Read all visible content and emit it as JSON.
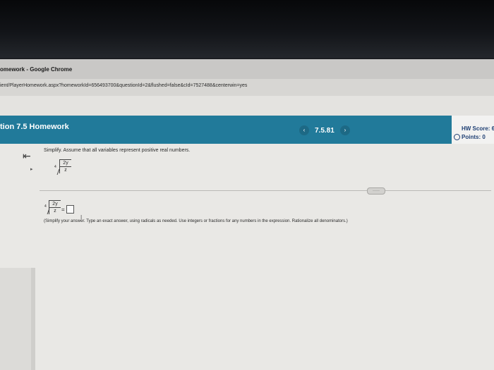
{
  "window": {
    "title": "omework - Google Chrome",
    "url": "ient/PlayerHomework.aspx?homeworkId=656493700&questionId=2&flushed=false&cId=7527488&centerwin=yes"
  },
  "header": {
    "title": "tion 7.5 Homework",
    "question_number": "7.5.81",
    "prev_glyph": "‹",
    "next_glyph": "›",
    "accent_color": "#217a9a"
  },
  "score": {
    "hw_score_label": "HW Score: 6",
    "points_label": "Points: 0"
  },
  "question": {
    "prompt": "Simplify. Assume that all variables represent positive real numbers.",
    "radical_index": "4",
    "numerator": "2y",
    "denominator": "z"
  },
  "answer": {
    "radical_index": "4",
    "numerator": "2y",
    "denominator": "z",
    "equals": "=",
    "instructions": "(Simplify your answer. Type an exact answer, using radicals as needed. Use integers or fractions for any numbers in the expression. Rationalize all denominators.)"
  },
  "toolbar": {
    "more_label": "·····"
  },
  "icons": {
    "back": "back-arrow-icon",
    "cursor": "text-cursor-icon"
  }
}
